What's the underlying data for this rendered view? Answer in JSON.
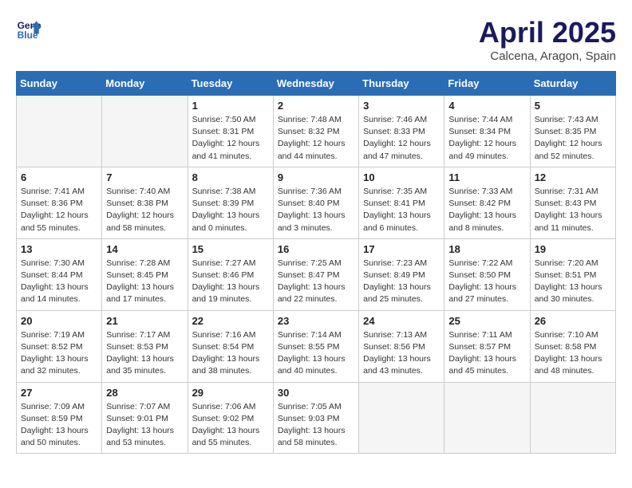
{
  "header": {
    "logo_line1": "General",
    "logo_line2": "Blue",
    "month_title": "April 2025",
    "location": "Calcena, Aragon, Spain"
  },
  "weekdays": [
    "Sunday",
    "Monday",
    "Tuesday",
    "Wednesday",
    "Thursday",
    "Friday",
    "Saturday"
  ],
  "weeks": [
    [
      {
        "day": "",
        "info": ""
      },
      {
        "day": "",
        "info": ""
      },
      {
        "day": "1",
        "info": "Sunrise: 7:50 AM\nSunset: 8:31 PM\nDaylight: 12 hours and 41 minutes."
      },
      {
        "day": "2",
        "info": "Sunrise: 7:48 AM\nSunset: 8:32 PM\nDaylight: 12 hours and 44 minutes."
      },
      {
        "day": "3",
        "info": "Sunrise: 7:46 AM\nSunset: 8:33 PM\nDaylight: 12 hours and 47 minutes."
      },
      {
        "day": "4",
        "info": "Sunrise: 7:44 AM\nSunset: 8:34 PM\nDaylight: 12 hours and 49 minutes."
      },
      {
        "day": "5",
        "info": "Sunrise: 7:43 AM\nSunset: 8:35 PM\nDaylight: 12 hours and 52 minutes."
      }
    ],
    [
      {
        "day": "6",
        "info": "Sunrise: 7:41 AM\nSunset: 8:36 PM\nDaylight: 12 hours and 55 minutes."
      },
      {
        "day": "7",
        "info": "Sunrise: 7:40 AM\nSunset: 8:38 PM\nDaylight: 12 hours and 58 minutes."
      },
      {
        "day": "8",
        "info": "Sunrise: 7:38 AM\nSunset: 8:39 PM\nDaylight: 13 hours and 0 minutes."
      },
      {
        "day": "9",
        "info": "Sunrise: 7:36 AM\nSunset: 8:40 PM\nDaylight: 13 hours and 3 minutes."
      },
      {
        "day": "10",
        "info": "Sunrise: 7:35 AM\nSunset: 8:41 PM\nDaylight: 13 hours and 6 minutes."
      },
      {
        "day": "11",
        "info": "Sunrise: 7:33 AM\nSunset: 8:42 PM\nDaylight: 13 hours and 8 minutes."
      },
      {
        "day": "12",
        "info": "Sunrise: 7:31 AM\nSunset: 8:43 PM\nDaylight: 13 hours and 11 minutes."
      }
    ],
    [
      {
        "day": "13",
        "info": "Sunrise: 7:30 AM\nSunset: 8:44 PM\nDaylight: 13 hours and 14 minutes."
      },
      {
        "day": "14",
        "info": "Sunrise: 7:28 AM\nSunset: 8:45 PM\nDaylight: 13 hours and 17 minutes."
      },
      {
        "day": "15",
        "info": "Sunrise: 7:27 AM\nSunset: 8:46 PM\nDaylight: 13 hours and 19 minutes."
      },
      {
        "day": "16",
        "info": "Sunrise: 7:25 AM\nSunset: 8:47 PM\nDaylight: 13 hours and 22 minutes."
      },
      {
        "day": "17",
        "info": "Sunrise: 7:23 AM\nSunset: 8:49 PM\nDaylight: 13 hours and 25 minutes."
      },
      {
        "day": "18",
        "info": "Sunrise: 7:22 AM\nSunset: 8:50 PM\nDaylight: 13 hours and 27 minutes."
      },
      {
        "day": "19",
        "info": "Sunrise: 7:20 AM\nSunset: 8:51 PM\nDaylight: 13 hours and 30 minutes."
      }
    ],
    [
      {
        "day": "20",
        "info": "Sunrise: 7:19 AM\nSunset: 8:52 PM\nDaylight: 13 hours and 32 minutes."
      },
      {
        "day": "21",
        "info": "Sunrise: 7:17 AM\nSunset: 8:53 PM\nDaylight: 13 hours and 35 minutes."
      },
      {
        "day": "22",
        "info": "Sunrise: 7:16 AM\nSunset: 8:54 PM\nDaylight: 13 hours and 38 minutes."
      },
      {
        "day": "23",
        "info": "Sunrise: 7:14 AM\nSunset: 8:55 PM\nDaylight: 13 hours and 40 minutes."
      },
      {
        "day": "24",
        "info": "Sunrise: 7:13 AM\nSunset: 8:56 PM\nDaylight: 13 hours and 43 minutes."
      },
      {
        "day": "25",
        "info": "Sunrise: 7:11 AM\nSunset: 8:57 PM\nDaylight: 13 hours and 45 minutes."
      },
      {
        "day": "26",
        "info": "Sunrise: 7:10 AM\nSunset: 8:58 PM\nDaylight: 13 hours and 48 minutes."
      }
    ],
    [
      {
        "day": "27",
        "info": "Sunrise: 7:09 AM\nSunset: 8:59 PM\nDaylight: 13 hours and 50 minutes."
      },
      {
        "day": "28",
        "info": "Sunrise: 7:07 AM\nSunset: 9:01 PM\nDaylight: 13 hours and 53 minutes."
      },
      {
        "day": "29",
        "info": "Sunrise: 7:06 AM\nSunset: 9:02 PM\nDaylight: 13 hours and 55 minutes."
      },
      {
        "day": "30",
        "info": "Sunrise: 7:05 AM\nSunset: 9:03 PM\nDaylight: 13 hours and 58 minutes."
      },
      {
        "day": "",
        "info": ""
      },
      {
        "day": "",
        "info": ""
      },
      {
        "day": "",
        "info": ""
      }
    ]
  ]
}
